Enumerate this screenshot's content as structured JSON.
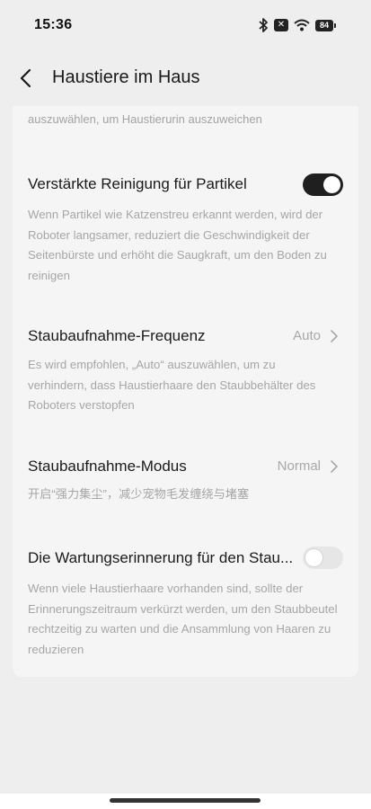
{
  "status_bar": {
    "time": "15:36",
    "battery": "84"
  },
  "header": {
    "title": "Haustiere im Haus"
  },
  "card": {
    "cut_text": "auszuwählen, um Haustierurin auszuweichen",
    "settings": [
      {
        "title": "Verstärkte Reinigung für Partikel",
        "control": "toggle",
        "enabled": true,
        "description": "Wenn Partikel wie Katzenstreu erkannt werden, wird der Roboter langsamer, reduziert die Geschwindigkeit der Seitenbürste und erhöht die Saugkraft, um den Boden zu reinigen"
      },
      {
        "title": "Staubaufnahme-Frequenz",
        "control": "select",
        "value": "Auto",
        "description": "Es wird empfohlen, „Auto“ auszuwählen, um zu verhindern, dass Haustierhaare den Staubbehälter des Roboters verstopfen"
      },
      {
        "title": "Staubaufnahme-Modus",
        "control": "select",
        "value": "Normal",
        "description": "开启“强力集尘”，减少宠物毛发缠绕与堵塞"
      },
      {
        "title": "Die Wartungserinnerung für den Stau...",
        "control": "toggle",
        "enabled": false,
        "description": "Wenn viele Haustierhaare vorhanden sind, sollte der Erinnerungszeitraum verkürzt werden, um den Staubbeutel rechtzeitig zu warten und die Ansammlung von Haaren zu reduzieren"
      }
    ]
  },
  "icons": {
    "status": [
      "bluetooth-icon",
      "x-badge-icon",
      "wifi-icon",
      "battery-icon"
    ],
    "header": "back-arrow-icon",
    "rows": "chevron-right-icon"
  },
  "colors": {
    "toggle_on": "#1f1f1f",
    "toggle_off": "#e6e6e6",
    "background": "#eeeeee",
    "card": "#f5f5f5"
  }
}
